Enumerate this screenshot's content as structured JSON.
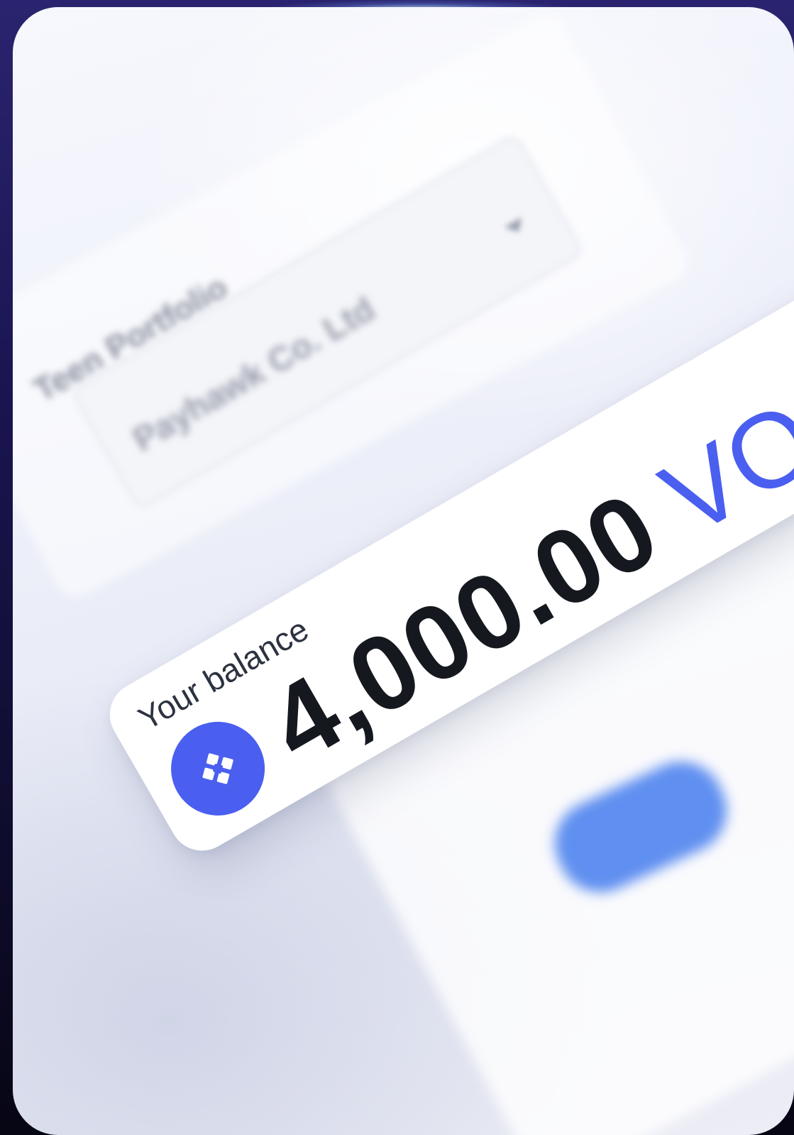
{
  "background": {
    "portfolio_label": "Teen Portfolio",
    "company_field_value": "Payhawk Co. Ltd",
    "dropdown_icon": "chevron-down-icon"
  },
  "balance_card": {
    "label": "Your balance",
    "amount": "4,000.00",
    "currency": "VOL",
    "token_icon": "token-logo-icon"
  },
  "colors": {
    "accent": "#4a5ff0",
    "text_dark": "#15181f"
  }
}
